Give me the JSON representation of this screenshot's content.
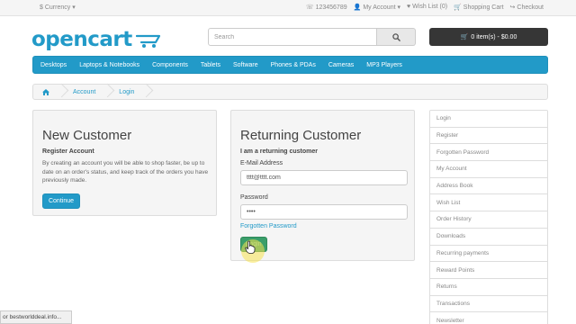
{
  "topbar": {
    "currency": "$ Currency",
    "phone": "123456789",
    "my_account": "My Account",
    "wish_list": "Wish List (0)",
    "shopping_cart": "Shopping Cart",
    "checkout": "Checkout"
  },
  "header": {
    "logo": "opencart",
    "search_placeholder": "Search",
    "cart_button": "0 item(s) - $0.00"
  },
  "menu": [
    "Desktops",
    "Laptops & Notebooks",
    "Components",
    "Tablets",
    "Software",
    "Phones & PDAs",
    "Cameras",
    "MP3 Players"
  ],
  "breadcrumb": [
    "Account",
    "Login"
  ],
  "new_customer": {
    "title": "New Customer",
    "subtitle": "Register Account",
    "text": "By creating an account you will be able to shop faster, be up to date on an order's status, and keep track of the orders you have previously made.",
    "button": "Continue"
  },
  "returning_customer": {
    "title": "Returning Customer",
    "subtitle": "I am a returning customer",
    "email_label": "E-Mail Address",
    "email_value": "tttt@tttt.com",
    "password_label": "Password",
    "password_value": "••••",
    "forgot": "Forgotten Password",
    "login_button": "Login"
  },
  "account_links": [
    "Login",
    "Register",
    "Forgotten Password",
    "My Account",
    "Address Book",
    "Wish List",
    "Order History",
    "Downloads",
    "Recurring payments",
    "Reward Points",
    "Returns",
    "Transactions",
    "Newsletter"
  ],
  "statusbar": "or bestworlddeal.info..."
}
